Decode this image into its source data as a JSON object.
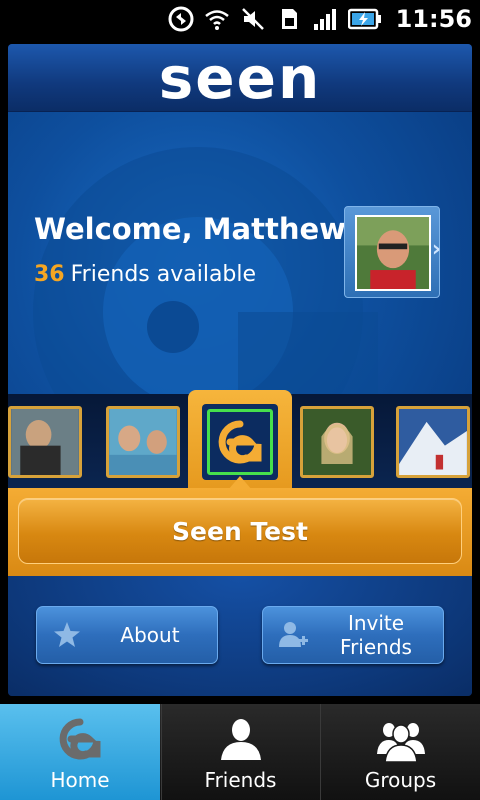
{
  "status_bar": {
    "time": "11:56",
    "icons": [
      "sync-icon",
      "wifi-icon",
      "mute-icon",
      "sim-icon",
      "signal-icon",
      "battery-charging-icon"
    ]
  },
  "app": {
    "logo_text": "seen",
    "welcome": "Welcome, Matthew!",
    "friends_count": "36",
    "friends_label": "Friends available",
    "selected_title": "Seen Test",
    "about_label": "About",
    "invite_label_line1": "Invite",
    "invite_label_line2": "Friends"
  },
  "bottom_nav": {
    "tabs": [
      {
        "label": "Home",
        "icon": "seen-logo-icon",
        "active": true
      },
      {
        "label": "Friends",
        "icon": "person-icon",
        "active": false
      },
      {
        "label": "Groups",
        "icon": "group-icon",
        "active": false
      }
    ]
  },
  "colors": {
    "accent_orange": "#f4ac34",
    "brand_blue": "#0e4f9e",
    "active_tab": "#1e95d4",
    "selected_frame": "#46e04c",
    "friends_count": "#f5a623"
  }
}
